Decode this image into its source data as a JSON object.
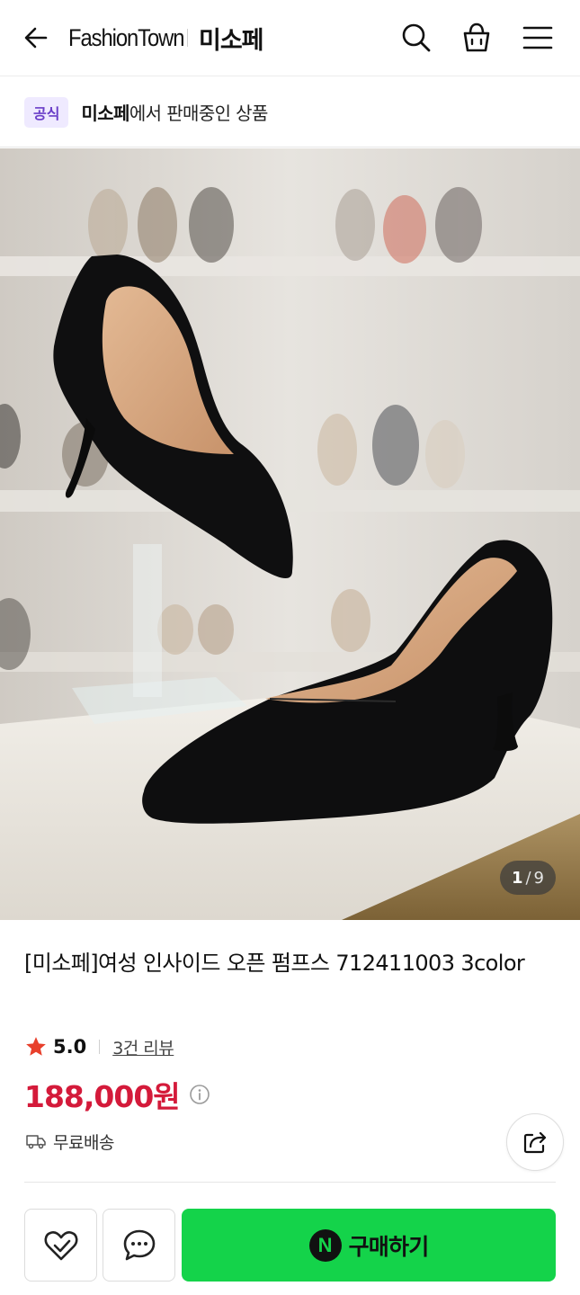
{
  "header": {
    "brand": "FashionTown",
    "store": "미소페"
  },
  "official": {
    "badge": "공식",
    "store": "미소페",
    "suffix": "에서 판매중인 상품"
  },
  "image": {
    "current": "1",
    "separator": "/",
    "total": "9"
  },
  "product": {
    "title": "[미소페]여성 인사이드 오픈 펌프스 712411003 3color",
    "rating": "5.0",
    "reviews": "3건 리뷰",
    "price": "188,000원",
    "shipping": "무료배송"
  },
  "bottom": {
    "buy_logo": "N",
    "buy_label": "구매하기"
  },
  "colors": {
    "price": "#d41a3a",
    "buy_button": "#14d34a",
    "star": "#e8402c",
    "badge_bg": "#efeaff",
    "badge_text": "#6a3ec8"
  },
  "icons": [
    "back-arrow-icon",
    "search-icon",
    "shopping-bag-icon",
    "menu-icon",
    "star-icon",
    "info-icon",
    "truck-icon",
    "share-icon",
    "heart-check-icon",
    "chat-icon"
  ]
}
